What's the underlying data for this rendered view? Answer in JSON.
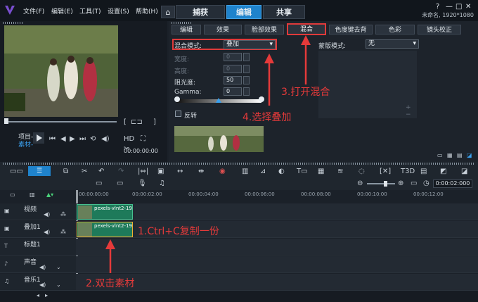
{
  "menu": [
    "文件(F)",
    "编辑(E)",
    "工具(T)",
    "设置(S)",
    "帮助(H)"
  ],
  "main_tabs": [
    "捕获",
    "编辑",
    "共享"
  ],
  "project_info": "未命名, 1920*1080",
  "sub_tabs": [
    "编辑",
    "效果",
    "脸部效果",
    "混合",
    "色度键去背",
    "色彩",
    "镜头校正"
  ],
  "blend": {
    "mode_label": "混合模式:",
    "mode_value": "叠加",
    "width_label": "宽度:",
    "height_label": "高度:",
    "width_value": "0",
    "height_value": "0",
    "alpha_label": "阻光度:",
    "alpha_value": "50",
    "gamma_label": "Gamma:",
    "gamma_value": "0",
    "invert_label": "反转",
    "mask_label": "蒙版模式:",
    "mask_value": "无"
  },
  "playback": {
    "project_label": "项目-",
    "clip_label": "素材-",
    "timecode": "00:00:00:00",
    "tc_right": "0:00:02:000"
  },
  "ruler": [
    "00:00:00:00",
    "00:00:02:00",
    "00:00:04:00",
    "00:00:06:00",
    "00:00:08:00",
    "00:00:10:00",
    "00:00:12:00"
  ],
  "tracks": [
    {
      "name": "视频",
      "clip": "pexels-vlnt2-19725"
    },
    {
      "name": "叠加1",
      "clip": "pexels-vlnt2-1972"
    },
    {
      "name": "标题1",
      "clip": ""
    },
    {
      "name": "声音",
      "clip": ""
    },
    {
      "name": "音乐1",
      "clip": ""
    }
  ],
  "annotations": {
    "a1": "1.Ctrl+C复制一份",
    "a2": "2.双击素材",
    "a3": "3.打开混合",
    "a4": "4.选择叠加"
  },
  "colors": {
    "accent": "#1f83cc",
    "annot": "#e53a3a",
    "clip": "#1e7a5a"
  }
}
